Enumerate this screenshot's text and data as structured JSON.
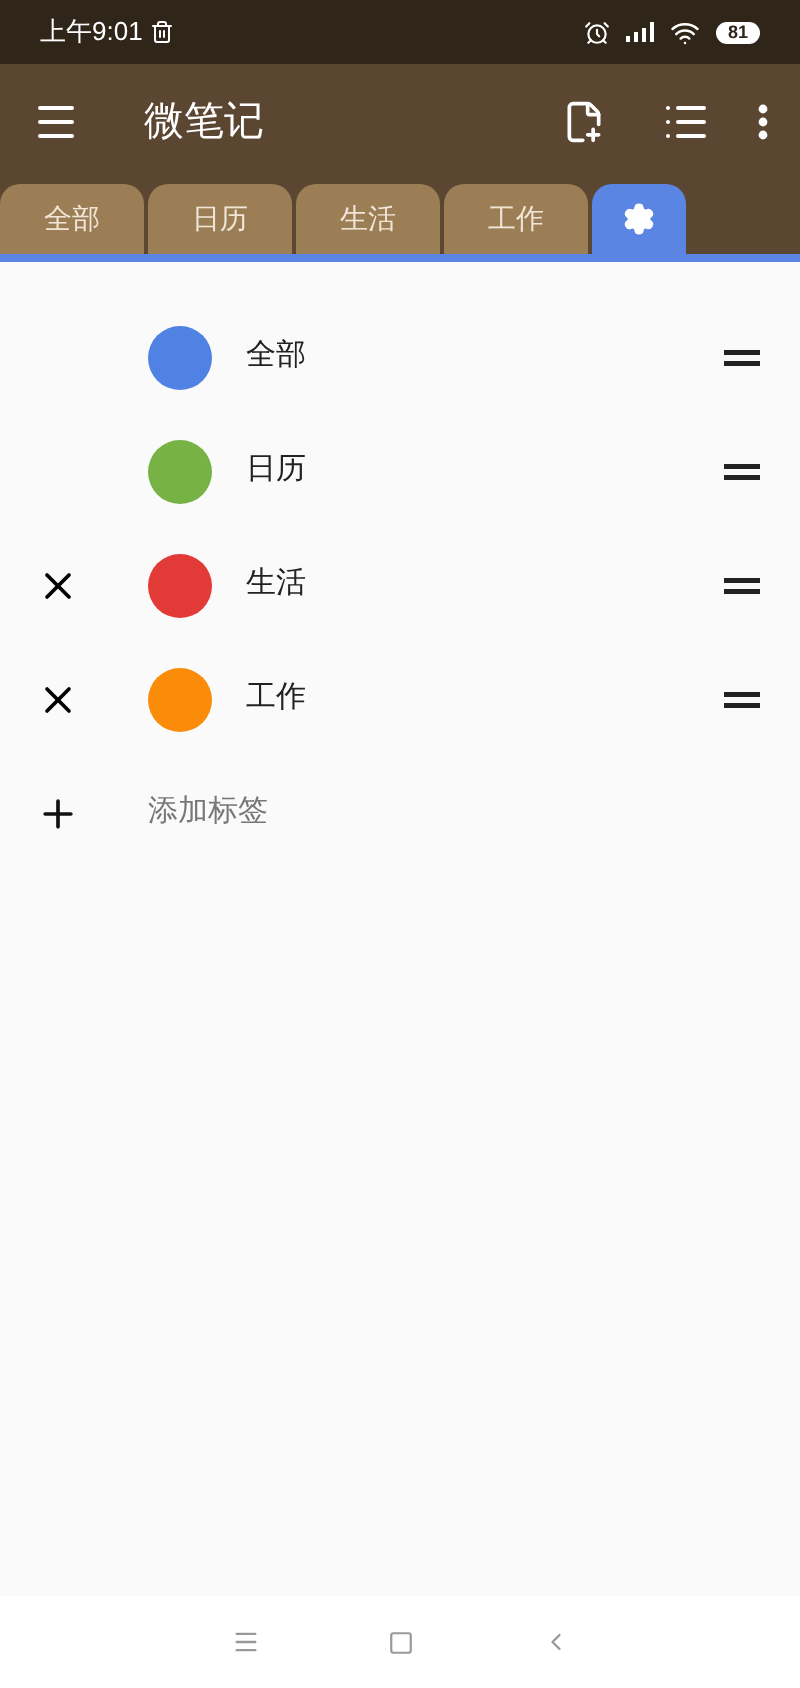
{
  "status_bar": {
    "time": "上午9:01",
    "battery": "81"
  },
  "app_bar": {
    "title": "微笔记"
  },
  "tabs": [
    {
      "kind": "text",
      "label": "全部",
      "selected": false
    },
    {
      "kind": "text",
      "label": "日历",
      "selected": false
    },
    {
      "kind": "text",
      "label": "生活",
      "selected": false
    },
    {
      "kind": "text",
      "label": "工作",
      "selected": false
    },
    {
      "kind": "settings",
      "selected": true
    }
  ],
  "tags": [
    {
      "name": "全部",
      "color": "#4f82e2",
      "deletable": false
    },
    {
      "name": "日历",
      "color": "#77b244",
      "deletable": false
    },
    {
      "name": "生活",
      "color": "#e23a36",
      "deletable": true
    },
    {
      "name": "工作",
      "color": "#fb8c0a",
      "deletable": true
    }
  ],
  "add_tag": {
    "label": "添加标签"
  }
}
